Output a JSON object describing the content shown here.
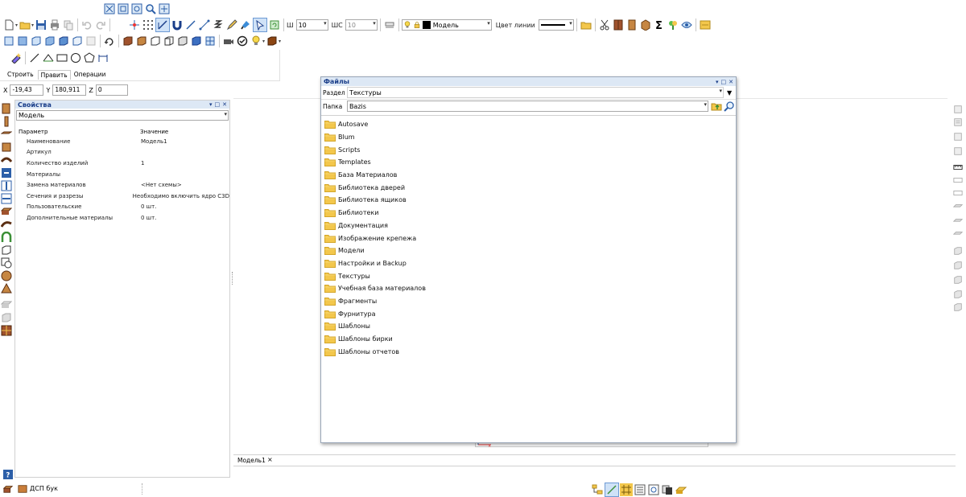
{
  "toolbar": {
    "width_label": "Ш",
    "width_value": "10",
    "step_label": "ШС",
    "step_value": "10",
    "layer_value": "Модель",
    "line_color_label": "Цвет линии"
  },
  "draw_panel": {
    "tabs": [
      {
        "label": "Строить"
      },
      {
        "label": "Править"
      },
      {
        "label": "Операции"
      }
    ]
  },
  "coords": {
    "x_label": "X",
    "x_value": "-19,43",
    "y_label": "Y",
    "y_value": "180,911",
    "z_label": "Z",
    "z_value": "0"
  },
  "properties": {
    "title": "Свойства",
    "object_value": "Модель",
    "header_param": "Параметр",
    "header_value": "Значение",
    "rows": [
      {
        "name": "Наименование",
        "value": "Модель1"
      },
      {
        "name": "Артикул",
        "value": ""
      },
      {
        "name": "Количество изделий",
        "value": "1"
      },
      {
        "name": "Материалы",
        "value": ""
      },
      {
        "name": "Замена материалов",
        "value": "<Нет схемы>"
      },
      {
        "name": "Сечения и разрезы",
        "value": "Необходимо включить ядро C3D"
      },
      {
        "name": "Пользовательские",
        "value": "0 шт."
      },
      {
        "name": "Дополнительные материалы",
        "value": "0 шт."
      }
    ]
  },
  "files": {
    "title": "Файлы",
    "section_label": "Раздел",
    "section_value": "Текстуры",
    "folder_label": "Папка",
    "folder_value": "Bazis",
    "items": [
      "Autosave",
      "Blum",
      "Scripts",
      "Templates",
      "База Материалов",
      "Библиотека дверей",
      "Библиотека ящиков",
      "Библиотеки",
      "Документация",
      "Изображение крепежа",
      "Модели",
      "Настройки и Backup",
      "Текстуры",
      "Учебная база материалов",
      "Фрагменты",
      "Фурнитура",
      "Шаблоны",
      "Шаблоны бирки",
      "Шаблоны отчетов"
    ]
  },
  "doc_tab": {
    "label": "Модель1",
    "close": "×"
  },
  "status": {
    "material": "ДСП бук"
  },
  "colors": {
    "accent": "#1a3e8a",
    "panel_header": "#dde8f5",
    "folder": "#f3c74c"
  }
}
